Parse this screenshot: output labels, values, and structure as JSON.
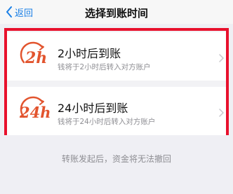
{
  "navbar": {
    "back_label": "返回",
    "title": "选择到账时间"
  },
  "options": [
    {
      "icon_name": "2h-clock-icon",
      "icon_text": "2h",
      "title": "2小时后到账",
      "description": "钱将于2小时后转入对方账户"
    },
    {
      "icon_name": "24h-clock-icon",
      "icon_text": "24h",
      "title": "24小时后到账",
      "description": "钱将于24小时后转入对方账户"
    }
  ],
  "footnote": "转账发起后，资金将无法撤回",
  "colors": {
    "accent_blue": "#1a7fe6",
    "highlight_red": "#e8112d",
    "icon_orange": "#e2542e"
  }
}
